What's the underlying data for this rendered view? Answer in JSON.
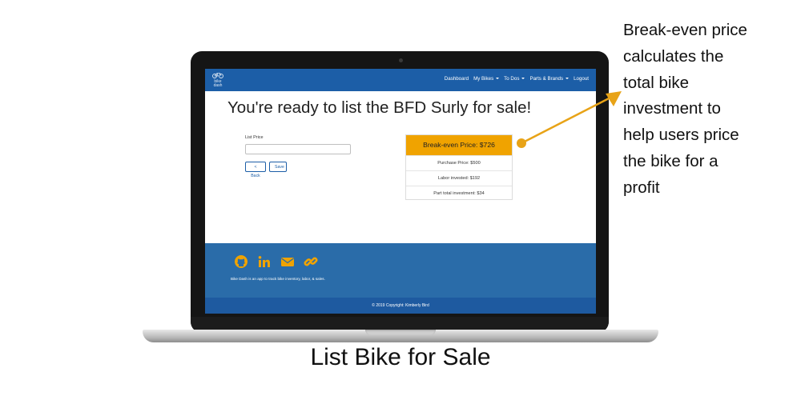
{
  "navbar": {
    "logo_line1": "bike",
    "logo_line2": "dash",
    "items": [
      {
        "label": "Dashboard",
        "dropdown": false
      },
      {
        "label": "My Bikes",
        "dropdown": true
      },
      {
        "label": "To Dos",
        "dropdown": true
      },
      {
        "label": "Parts & Brands",
        "dropdown": true
      },
      {
        "label": "Logout",
        "dropdown": false
      }
    ]
  },
  "main": {
    "headline": "You're ready to list the BFD Surly for sale!",
    "list_price_label": "List Price",
    "list_price_value": "",
    "back_button": "< Back",
    "save_button": "Save"
  },
  "breakeven_card": {
    "header": "Break-even Price: $726",
    "rows": [
      "Purchase Price: $500",
      "Labor invested: $192",
      "Part total investment: $34"
    ],
    "accent_color": "#f0a300"
  },
  "footer": {
    "icons": [
      "github-icon",
      "linkedin-icon",
      "email-icon",
      "link-icon"
    ],
    "icon_color": "#f0a300",
    "description": "Bike Dash is an app to track bike inventory, labor, & sales.",
    "copyright": "© 2019 Copyright: Kimberly Bird"
  },
  "annotation": {
    "lines": [
      "Break-even price",
      "calculates the",
      "total bike",
      "investment to",
      "help users price",
      "the bike for a",
      "profit"
    ],
    "arrow_color": "#e8a317"
  },
  "caption": "List Bike for Sale"
}
